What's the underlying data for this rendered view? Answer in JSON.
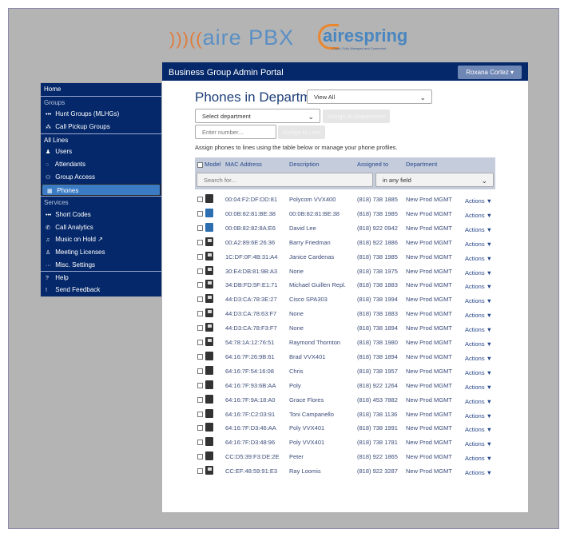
{
  "logos": {
    "airepbx": "aire PBX",
    "airespring": "airespring",
    "airespring_tagline": "Cloud, Fully Managed and Connected"
  },
  "header": {
    "title": "Business Group Admin Portal",
    "user": "Roxana Cortez"
  },
  "sidebar": [
    {
      "label": "Home",
      "type": "head"
    },
    {
      "label": "Groups",
      "type": "section"
    },
    {
      "label": "Hunt Groups (MLHGs)",
      "icon": "dots-icon",
      "glyph": "•••"
    },
    {
      "label": "Call Pickup Groups",
      "icon": "group-tree-icon",
      "glyph": "⁂"
    },
    {
      "label": "All Lines",
      "type": "section2"
    },
    {
      "label": "Users",
      "icon": "user-icon",
      "glyph": "♟"
    },
    {
      "label": "Attendants",
      "icon": "headset-icon",
      "glyph": "◌"
    },
    {
      "label": "Group Access",
      "icon": "users-icon",
      "glyph": "⚇"
    },
    {
      "label": "Phones",
      "icon": "phone-icon",
      "glyph": "▦",
      "active": true
    },
    {
      "label": "Services",
      "type": "section"
    },
    {
      "label": "Short Codes",
      "icon": "dots-icon",
      "glyph": "•••"
    },
    {
      "label": "Call Analytics",
      "icon": "phone-call-icon",
      "glyph": "✆"
    },
    {
      "label": "Music on Hold ↗",
      "icon": "music-icon",
      "glyph": "♫"
    },
    {
      "label": "Meeting Licenses",
      "icon": "presenter-icon",
      "glyph": "♙"
    },
    {
      "label": "Misc. Settings",
      "icon": "ellipsis-icon",
      "glyph": "···"
    },
    {
      "label": "Help",
      "icon": "question-icon",
      "glyph": "?",
      "sep": true
    },
    {
      "label": "Send Feedback",
      "icon": "exclamation-icon",
      "glyph": "!"
    }
  ],
  "main": {
    "title": "Phones in Department:",
    "dept_filter": "View All",
    "select_department": "Select department",
    "assign_dept_button": "Assign to Department",
    "number_placeholder": "Enter number...",
    "assign_line_button": "Assign to Line",
    "hint": "Assign phones to lines using the table below or manage your phone profiles.",
    "columns": [
      "Model",
      "MAC Address",
      "Description",
      "Assigned to",
      "Department"
    ],
    "search_placeholder": "Search for...",
    "search_field": "in any field",
    "actions_label": "Actions ▼"
  },
  "rows": [
    {
      "model": "polycom",
      "mac": "00:04:F2:DF:DD:81",
      "desc": "Polycom VVX400",
      "num": "(818) 738 1885",
      "dept": "New Prod MGMT"
    },
    {
      "model": "blue",
      "mac": "00:0B:82:81:BE:38",
      "desc": "00:0B:82:81:BE:38",
      "num": "(818) 738 1985",
      "dept": "New Prod MGMT"
    },
    {
      "model": "blue",
      "mac": "00:0B:82:82:8A:E6",
      "desc": "David Lee",
      "num": "(818) 922 0942",
      "dept": "New Prod MGMT"
    },
    {
      "model": "light",
      "mac": "00:A2:89:6E:26:36",
      "desc": "Barry Friedman",
      "num": "(818) 922 1886",
      "dept": "New Prod MGMT"
    },
    {
      "model": "light",
      "mac": "1C:DF:0F:4B:31:A4",
      "desc": "Janice Cardenas",
      "num": "(818) 738 1985",
      "dept": "New Prod MGMT"
    },
    {
      "model": "light",
      "mac": "30:E4:DB:81:9B:A3",
      "desc": "None",
      "num": "(818) 738 1975",
      "dept": "New Prod MGMT"
    },
    {
      "model": "light",
      "mac": "34:DB:FD:5F:E1:71",
      "desc": "Michael Guillen Repl.",
      "num": "(818) 738 1883",
      "dept": "New Prod MGMT"
    },
    {
      "model": "light",
      "mac": "44:D3:CA:78:3E:27",
      "desc": "Cisco SPA303",
      "num": "(818) 738 1994",
      "dept": "New Prod MGMT"
    },
    {
      "model": "light",
      "mac": "44:D3:CA:78:63:F7",
      "desc": "None",
      "num": "(818) 738 1883",
      "dept": "New Prod MGMT"
    },
    {
      "model": "light",
      "mac": "44:D3:CA:78:F3:F7",
      "desc": "None",
      "num": "(818) 738 1894",
      "dept": "New Prod MGMT"
    },
    {
      "model": "light",
      "mac": "54:78:1A:12:76:51",
      "desc": "Raymond Thornton",
      "num": "(818) 738 1980",
      "dept": "New Prod MGMT"
    },
    {
      "model": "polycom",
      "mac": "64:16:7F:26:9B:61",
      "desc": "Brad VVX401",
      "num": "(818) 738 1894",
      "dept": "New Prod MGMT"
    },
    {
      "model": "polycom",
      "mac": "64:16:7F:54:16:08",
      "desc": "Chris",
      "num": "(818) 738 1957",
      "dept": "New Prod MGMT"
    },
    {
      "model": "polycom",
      "mac": "64:16:7F:93:6B:AA",
      "desc": "Poly",
      "num": "(818) 922 1264",
      "dept": "New Prod MGMT"
    },
    {
      "model": "polycom",
      "mac": "64:16:7F:9A:18:A0",
      "desc": "Grace Flores",
      "num": "(818) 453 7882",
      "dept": "New Prod MGMT"
    },
    {
      "model": "polycom",
      "mac": "64:16:7F:C2:03:91",
      "desc": "Toni Campanello",
      "num": "(818) 738 1136",
      "dept": "New Prod MGMT"
    },
    {
      "model": "polycom",
      "mac": "64:16:7F:D3:46:AA",
      "desc": "Poly VVX401",
      "num": "(818) 738 1991",
      "dept": "New Prod MGMT"
    },
    {
      "model": "polycom",
      "mac": "64:16:7F:D3:48:96",
      "desc": "Poly VVX401",
      "num": "(818) 738 1781",
      "dept": "New Prod MGMT"
    },
    {
      "model": "dark",
      "mac": "CC:D5:39:F3:DE:2E",
      "desc": "Peter",
      "num": "(818) 922 1865",
      "dept": "New Prod MGMT"
    },
    {
      "model": "light",
      "mac": "CC:EF:48:59:91:E3",
      "desc": "Ray Loomis",
      "num": "(818) 922 3287",
      "dept": "New Prod MGMT"
    }
  ]
}
